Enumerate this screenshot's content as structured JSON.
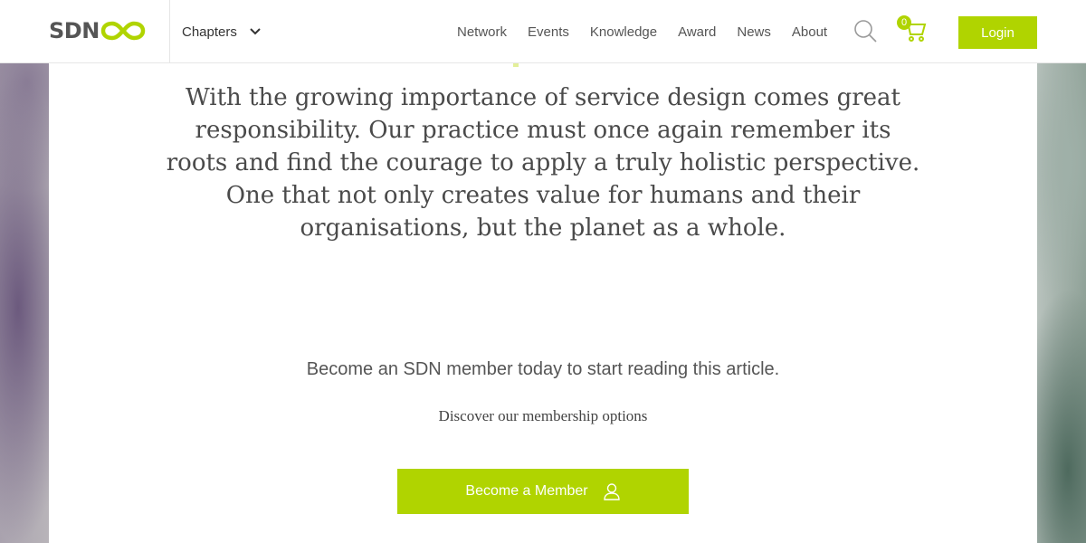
{
  "brand": {
    "logo_text": "SDN",
    "accent_color": "#b0d400"
  },
  "header": {
    "chapters_label": "Chapters",
    "nav": [
      "Network",
      "Events",
      "Knowledge",
      "Award",
      "News",
      "About"
    ],
    "cart_count": "0",
    "login_label": "Login",
    "icons": {
      "search": "search-icon",
      "cart": "cart-icon",
      "chevron": "chevron-down-icon"
    }
  },
  "article": {
    "quote": "With the growing importance of service design comes great responsibility. Our practice must once again remember its roots and find the courage to apply a truly holistic perspective. One that not only creates value for humans and their organisations, but the planet as a whole.",
    "paywall_text": "Become an SDN member today to start reading this article.",
    "discover_text": "Discover our membership options",
    "member_button": "Become a Member"
  }
}
